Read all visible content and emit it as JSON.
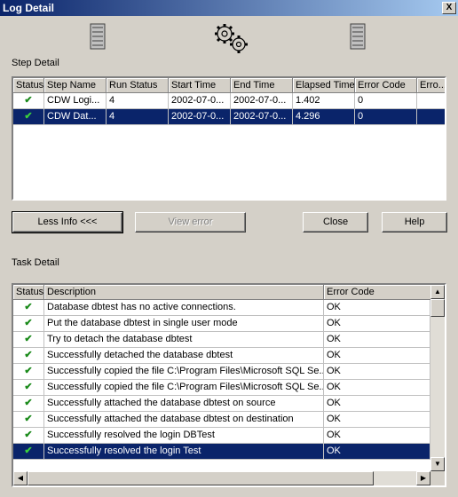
{
  "window": {
    "title": "Log Detail",
    "close": "X"
  },
  "icons": {
    "left": "server-icon",
    "center": "gears-icon",
    "right": "server-icon"
  },
  "step_detail": {
    "label": "Step Detail",
    "columns": [
      "Status",
      "Step Name",
      "Run Status",
      "Start Time",
      "End Time",
      "Elapsed Time",
      "Error Code",
      "Erro..."
    ],
    "rows": [
      {
        "status": "✔",
        "step_name": "CDW Logi...",
        "run_status": "4",
        "start_time": "2002-07-0...",
        "end_time": "2002-07-0...",
        "elapsed": "1.402",
        "error_code": "0",
        "error": "",
        "selected": false
      },
      {
        "status": "✔",
        "step_name": "CDW Dat...",
        "run_status": "4",
        "start_time": "2002-07-0...",
        "end_time": "2002-07-0...",
        "elapsed": "4.296",
        "error_code": "0",
        "error": "",
        "selected": true
      }
    ]
  },
  "buttons": {
    "less_info": "Less Info <<<",
    "view_error": "View error",
    "close": "Close",
    "help": "Help"
  },
  "task_detail": {
    "label": "Task Detail",
    "columns": [
      "Status",
      "Description",
      "Error Code"
    ],
    "rows": [
      {
        "status": "✔",
        "description": "Database dbtest has no active connections.",
        "error_code": "OK",
        "selected": false
      },
      {
        "status": "✔",
        "description": "Put the database dbtest in single user mode",
        "error_code": "OK",
        "selected": false
      },
      {
        "status": "✔",
        "description": "Try to detach the database dbtest",
        "error_code": "OK",
        "selected": false
      },
      {
        "status": "✔",
        "description": "Successfully detached the database dbtest",
        "error_code": "OK",
        "selected": false
      },
      {
        "status": "✔",
        "description": "Successfully copied the file C:\\Program Files\\Microsoft SQL Se...",
        "error_code": "OK",
        "selected": false
      },
      {
        "status": "✔",
        "description": "Successfully copied the file C:\\Program Files\\Microsoft SQL Se...",
        "error_code": "OK",
        "selected": false
      },
      {
        "status": "✔",
        "description": "Successfully attached the database dbtest on source",
        "error_code": "OK",
        "selected": false
      },
      {
        "status": "✔",
        "description": "Successfully attached the database dbtest on destination",
        "error_code": "OK",
        "selected": false
      },
      {
        "status": "✔",
        "description": "Successfully resolved the login DBTest",
        "error_code": "OK",
        "selected": false
      },
      {
        "status": "✔",
        "description": "Successfully resolved the login Test",
        "error_code": "OK",
        "selected": true
      }
    ]
  },
  "colors": {
    "selection": "#0a246a",
    "check": "#1a8a1a",
    "titlebar_start": "#0a246a",
    "titlebar_end": "#a6caf0"
  }
}
